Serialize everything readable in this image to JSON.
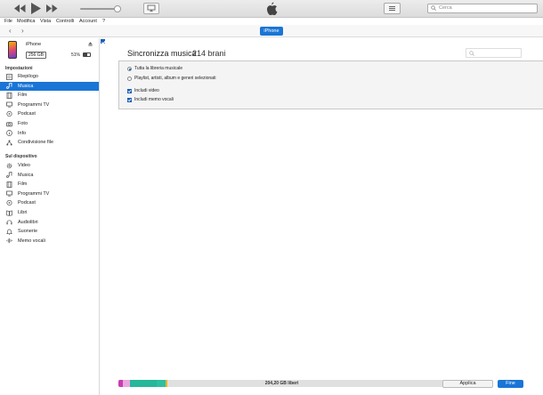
{
  "toolbar": {
    "rewind_icon": "rewind-icon",
    "play_icon": "play-icon",
    "forward_icon": "fast-forward-icon",
    "volume_level": 0.9,
    "search_placeholder": "Cerca"
  },
  "menubar": {
    "items": [
      "File",
      "Modifica",
      "Vista",
      "Controlli",
      "Account",
      "?"
    ]
  },
  "nav": {
    "device_button": "iPhone"
  },
  "device": {
    "name": "iPhone",
    "capacity": "256 GB",
    "battery": "51%",
    "battery_level": 0.51
  },
  "sidebar": {
    "settings_title": "Impostazioni",
    "settings_items": [
      {
        "label": "Riepilogo",
        "icon": "summary-icon"
      },
      {
        "label": "Musica",
        "icon": "music-note-icon",
        "active": true
      },
      {
        "label": "Film",
        "icon": "film-icon"
      },
      {
        "label": "Programmi TV",
        "icon": "tv-icon"
      },
      {
        "label": "Podcast",
        "icon": "podcast-icon"
      },
      {
        "label": "Foto",
        "icon": "camera-icon"
      },
      {
        "label": "Info",
        "icon": "info-icon"
      },
      {
        "label": "Condivisione file",
        "icon": "file-sharing-icon"
      }
    ],
    "device_title": "Sul dispositivo",
    "device_items": [
      {
        "label": "Video",
        "icon": "gear-video-icon"
      },
      {
        "label": "Musica",
        "icon": "music-note-icon"
      },
      {
        "label": "Film",
        "icon": "film-icon"
      },
      {
        "label": "Programmi TV",
        "icon": "tv-icon"
      },
      {
        "label": "Podcast",
        "icon": "podcast-icon"
      },
      {
        "label": "Libri",
        "icon": "book-icon"
      },
      {
        "label": "Audiolibri",
        "icon": "audiobook-icon"
      },
      {
        "label": "Suonerie",
        "icon": "bell-icon"
      },
      {
        "label": "Memo vocali",
        "icon": "voice-memo-icon"
      }
    ]
  },
  "main": {
    "sync_title": "Sincronizza musica",
    "sync_count": "214 brani",
    "sync_checked": true,
    "options": {
      "radio_all": "Tutta la libreria musicale",
      "radio_selected": "Playlist, artisti, album e generi selezionati",
      "check_videos": "Includi video",
      "check_voice_memos": "Includi memo vocali"
    }
  },
  "footer": {
    "free_space": "204,20 GB liberi",
    "apply_button": "Applica",
    "done_button": "Fine",
    "segment_colors": [
      "#c93cb1",
      "#e9a7e0",
      "#27b79a",
      "#2ebfa0",
      "#f2b41f"
    ]
  }
}
